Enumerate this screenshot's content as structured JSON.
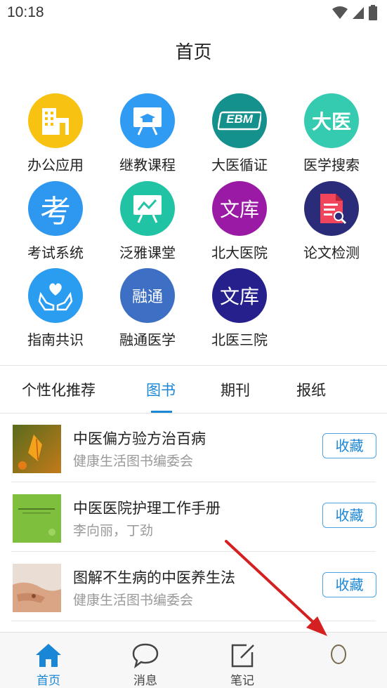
{
  "status": {
    "time": "10:18"
  },
  "header": {
    "title": "首页"
  },
  "apps": [
    {
      "label": "办公应用",
      "icon": "office-building-icon",
      "color": "#f7c211"
    },
    {
      "label": "继教课程",
      "icon": "presentation-board-icon",
      "color": "#2f9bf2"
    },
    {
      "label": "大医循证",
      "icon": "ebm-logo-icon",
      "color": "#14908d",
      "logo_text": "EBM"
    },
    {
      "label": "医学搜索",
      "icon": "daiyi-logo-icon",
      "color": "#35cbb1",
      "logo_text": "大医"
    },
    {
      "label": "考试系统",
      "icon": "exam-icon",
      "color": "#2e97ef",
      "logo_text": "考"
    },
    {
      "label": "泛雅课堂",
      "icon": "chart-board-icon",
      "color": "#20c3a4"
    },
    {
      "label": "北大医院",
      "icon": "library-icon",
      "color": "#9a1aa6",
      "logo_text": "文库"
    },
    {
      "label": "论文检测",
      "icon": "document-search-icon",
      "color": "#2a2c7a"
    },
    {
      "label": "指南共识",
      "icon": "heart-hands-icon",
      "color": "#2a9df0"
    },
    {
      "label": "融通医学",
      "icon": "rongtong-logo-icon",
      "color": "#3d6fc4",
      "logo_text": "融通"
    },
    {
      "label": "北医三院",
      "icon": "library-icon",
      "color": "#25208c",
      "logo_text": "文库"
    }
  ],
  "tabs": [
    {
      "label": "个性化推荐",
      "active": false
    },
    {
      "label": "图书",
      "active": true
    },
    {
      "label": "期刊",
      "active": false
    },
    {
      "label": "报纸",
      "active": false
    }
  ],
  "books": [
    {
      "title": "中医偏方验方治百病",
      "author": "健康生活图书编委会",
      "action": "收藏"
    },
    {
      "title": "中医医院护理工作手册",
      "author": "李向丽，丁劲",
      "action": "收藏"
    },
    {
      "title": "图解不生病的中医养生法",
      "author": "健康生活图书编委会",
      "action": "收藏"
    }
  ],
  "bottom_nav": [
    {
      "label": "首页",
      "icon": "home-icon",
      "active": true
    },
    {
      "label": "消息",
      "icon": "chat-bubble-icon",
      "active": false
    },
    {
      "label": "笔记",
      "icon": "note-edit-icon",
      "active": false
    },
    {
      "label": "",
      "icon": "profile-icon",
      "active": false
    }
  ],
  "colors": {
    "accent": "#1a86d6",
    "annotation_arrow": "#d42020"
  }
}
